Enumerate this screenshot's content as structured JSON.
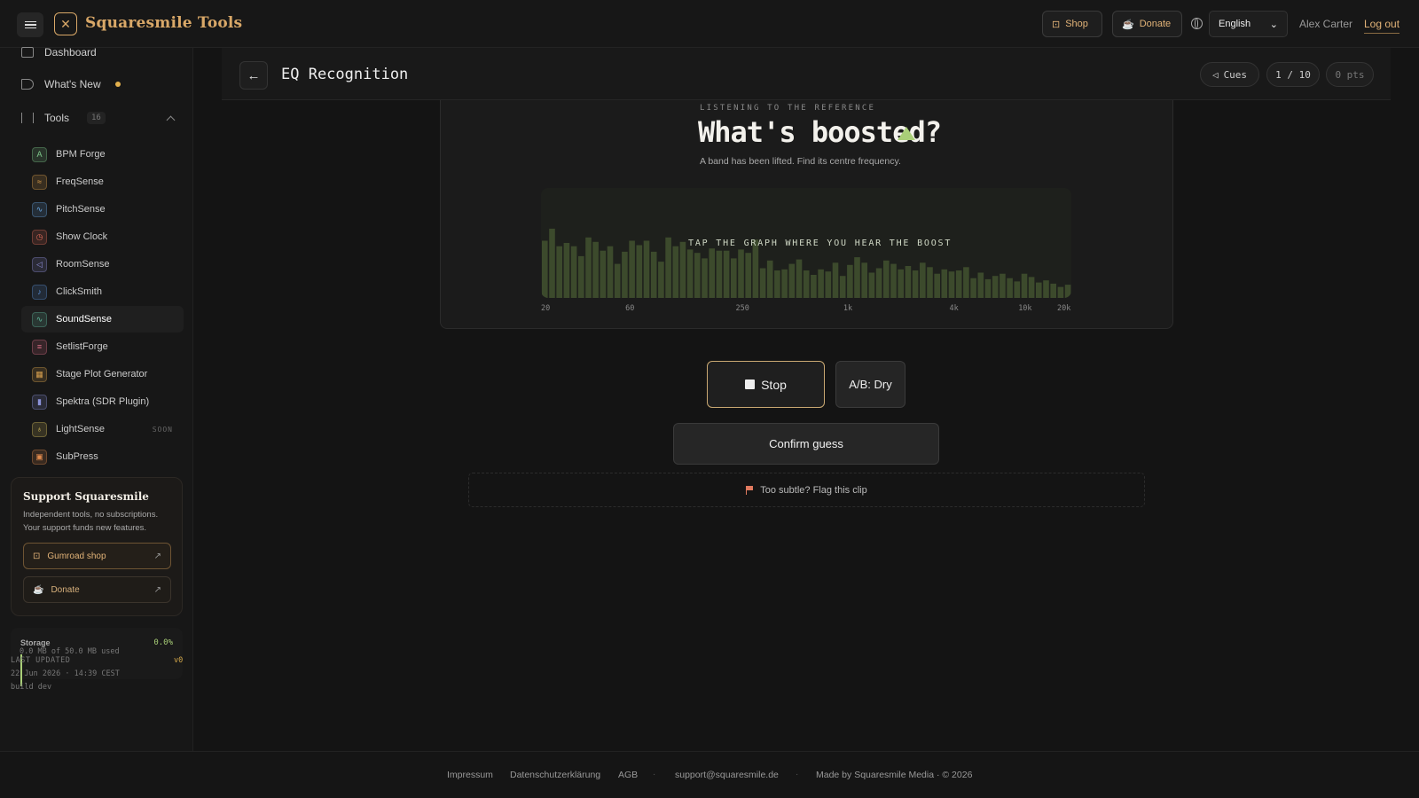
{
  "app": {
    "brand_name": "Squaresmile Tools",
    "brand_icon": "x-logo-icon",
    "accent_color": "#d9a868",
    "success_color": "#a9cf78"
  },
  "topbar": {
    "shop_label": "Shop",
    "donate_label": "Donate",
    "language": "English",
    "user_name": "Alex Carter",
    "logout_label": "Log out"
  },
  "sidebar": {
    "dashboard_label": "Dashboard",
    "whats_new_label": "What's New",
    "tools_label": "Tools",
    "tools_count": "16",
    "tools": [
      {
        "label": "BPM Forge",
        "icon": "metronome-icon",
        "color": "#7fc98c",
        "glyph": "A"
      },
      {
        "label": "FreqSense",
        "icon": "wave-icon",
        "color": "#e0a24d",
        "glyph": "≈"
      },
      {
        "label": "PitchSense",
        "icon": "pulse-icon",
        "color": "#69a6e0",
        "glyph": "∿"
      },
      {
        "label": "Show Clock",
        "icon": "clock-icon",
        "color": "#e06b5a",
        "glyph": "◷"
      },
      {
        "label": "RoomSense",
        "icon": "speaker-icon",
        "color": "#8f8fd9",
        "glyph": "◁"
      },
      {
        "label": "ClickSmith",
        "icon": "note-icon",
        "color": "#5d92d9",
        "glyph": "♪"
      },
      {
        "label": "SoundSense",
        "icon": "pulse-icon",
        "color": "#5fb79b",
        "glyph": "∿"
      },
      {
        "label": "SetlistForge",
        "icon": "list-icon",
        "color": "#d96f86",
        "glyph": "≡"
      },
      {
        "label": "Stage Plot Generator",
        "icon": "grid-icon",
        "color": "#d9a14f",
        "glyph": "▦"
      },
      {
        "label": "Spektra (SDR Plugin)",
        "icon": "bars-icon",
        "color": "#8c93d9",
        "glyph": "▮"
      },
      {
        "label": "LightSense",
        "icon": "bulb-icon",
        "color": "#d9c35f",
        "glyph": "♁",
        "badge": "SOON"
      },
      {
        "label": "SubPress",
        "icon": "squares-icon",
        "color": "#e08a4d",
        "glyph": "▣"
      }
    ],
    "active_tool": "SoundSense",
    "support": {
      "title": "Support Squaresmile",
      "text": "Independent tools, no subscriptions. Your support funds new features.",
      "gumroad_label": "Gumroad shop",
      "donate_label": "Donate"
    },
    "storage": {
      "label": "Storage",
      "percent": "0.0%",
      "used": "0.0 MB of 50.0 MB used"
    },
    "last_updated_label": "LAST UPDATED",
    "version": "v0",
    "update_date": "22 Jun 2026 · 14:39 CEST",
    "build": "build dev"
  },
  "main": {
    "title": "EQ Recognition",
    "cues_label": "Cues",
    "round": "1 / 10",
    "points": "0 pts",
    "listening_label": "LISTENING TO THE REFERENCE",
    "question": "What's boosted?",
    "question_sub": "A band has been lifted. Find its centre frequency.",
    "graph_hint": "TAP THE GRAPH WHERE YOU HEAR THE BOOST",
    "x_ticks": [
      {
        "label": "20",
        "x": 0.0
      },
      {
        "label": "60",
        "x": 0.159
      },
      {
        "label": "250",
        "x": 0.367
      },
      {
        "label": "1k",
        "x": 0.57
      },
      {
        "label": "4k",
        "x": 0.77
      },
      {
        "label": "10k",
        "x": 0.9
      },
      {
        "label": "20k",
        "x": 1.0
      }
    ],
    "spectrum_levels": [
      0.52,
      0.63,
      0.47,
      0.5,
      0.47,
      0.38,
      0.55,
      0.51,
      0.43,
      0.47,
      0.31,
      0.42,
      0.52,
      0.48,
      0.52,
      0.42,
      0.33,
      0.55,
      0.47,
      0.51,
      0.44,
      0.41,
      0.36,
      0.45,
      0.43,
      0.43,
      0.36,
      0.44,
      0.41,
      0.53,
      0.27,
      0.34,
      0.25,
      0.26,
      0.31,
      0.35,
      0.25,
      0.21,
      0.26,
      0.24,
      0.32,
      0.2,
      0.3,
      0.37,
      0.32,
      0.23,
      0.27,
      0.34,
      0.31,
      0.26,
      0.29,
      0.25,
      0.32,
      0.28,
      0.22,
      0.26,
      0.24,
      0.25,
      0.28,
      0.18,
      0.23,
      0.17,
      0.2,
      0.22,
      0.18,
      0.15,
      0.22,
      0.19,
      0.14,
      0.16,
      0.13,
      0.1,
      0.12
    ],
    "stop_label": "Stop",
    "ab_label": "A/B: Dry",
    "confirm_label": "Confirm guess",
    "flag_label": "Too subtle? Flag this clip"
  },
  "footer": {
    "impressum": "Impressum",
    "privacy": "Datenschutzerklärung",
    "agb": "AGB",
    "email": "support@squaresmile.de",
    "made_by": "Made by Squaresmile Media · © 2026"
  }
}
